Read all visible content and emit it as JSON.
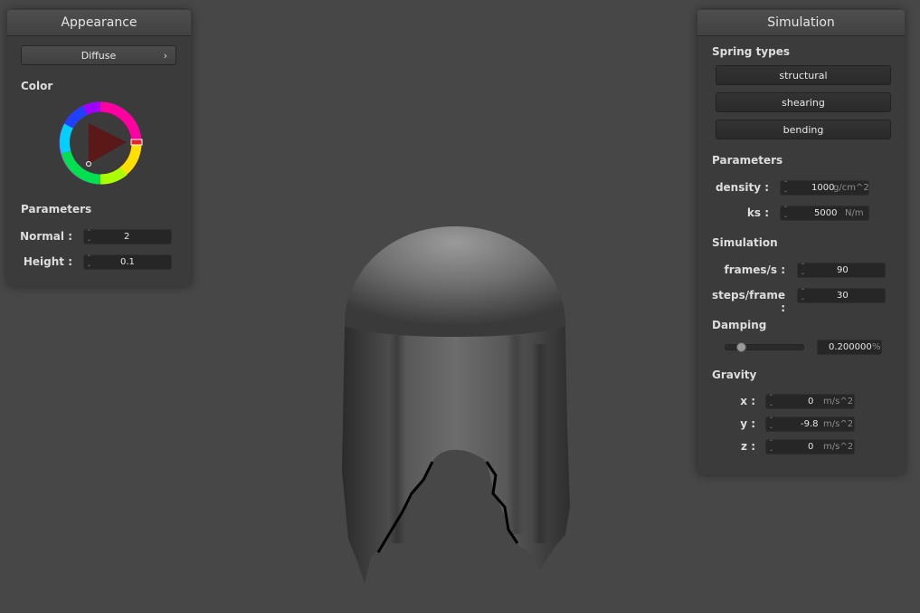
{
  "appearance": {
    "title": "Appearance",
    "shader": "Diffuse",
    "color_label": "Color",
    "parameters_label": "Parameters",
    "normal": {
      "label": "Normal :",
      "value": "2"
    },
    "height": {
      "label": "Height :",
      "value": "0.1"
    },
    "colors": {
      "picked": "#e8222a"
    }
  },
  "simulation": {
    "title": "Simulation",
    "spring_types": {
      "label": "Spring types",
      "structural": "structural",
      "shearing": "shearing",
      "bending": "bending"
    },
    "parameters": {
      "label": "Parameters",
      "density": {
        "label": "density :",
        "value": "1000",
        "unit": "g/cm^2"
      },
      "ks": {
        "label": "ks :",
        "value": "5000",
        "unit": "N/m"
      }
    },
    "sim": {
      "label": "Simulation",
      "fps": {
        "label": "frames/s :",
        "value": "90"
      },
      "steps": {
        "label": "steps/frame :",
        "value": "30"
      }
    },
    "damping": {
      "label": "Damping",
      "value": "0.200000",
      "unit": "%",
      "slider_fraction": 0.2
    },
    "gravity": {
      "label": "Gravity",
      "x": {
        "label": "x :",
        "value": "0",
        "unit": "m/s^2"
      },
      "y": {
        "label": "y :",
        "value": "-9.8",
        "unit": "m/s^2"
      },
      "z": {
        "label": "z :",
        "value": "0",
        "unit": "m/s^2"
      }
    }
  }
}
